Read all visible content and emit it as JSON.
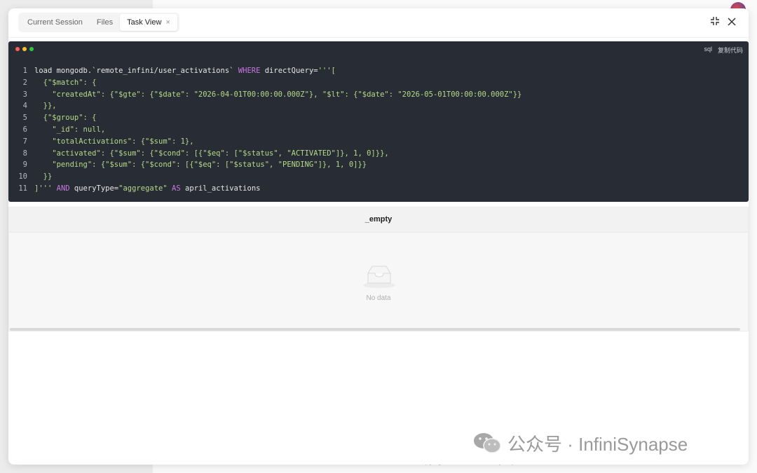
{
  "background": {
    "footer_text": "Copyright © 2025 InfiniSynapse"
  },
  "tabs": [
    {
      "label": "Current Session",
      "active": false
    },
    {
      "label": "Files",
      "active": false
    },
    {
      "label": "Task View",
      "active": true
    }
  ],
  "tab_close_glyph": "×",
  "header_actions": {
    "collapse_icon": "⤡",
    "close_icon": "✕"
  },
  "code": {
    "language": "sql",
    "copy_label": "复制代码",
    "lines": [
      {
        "n": "1",
        "segments": [
          [
            "plain",
            "load mongodb.`remote_infini/user_activations` "
          ],
          [
            "kw",
            "WHERE"
          ],
          [
            "plain",
            " directQuery="
          ],
          [
            "str",
            "'''["
          ]
        ]
      },
      {
        "n": "2",
        "segments": [
          [
            "str",
            "  {\"$match\": {"
          ]
        ]
      },
      {
        "n": "3",
        "segments": [
          [
            "str",
            "    \"createdAt\": {\"$gte\": {\"$date\": \"2026-04-01T00:00:00.000Z\"}, \"$lt\": {\"$date\": \"2026-05-01T00:00:00.000Z\"}}"
          ]
        ]
      },
      {
        "n": "4",
        "segments": [
          [
            "str",
            "  }},"
          ]
        ]
      },
      {
        "n": "5",
        "segments": [
          [
            "str",
            "  {\"$group\": {"
          ]
        ]
      },
      {
        "n": "6",
        "segments": [
          [
            "str",
            "    \"_id\": null,"
          ]
        ]
      },
      {
        "n": "7",
        "segments": [
          [
            "str",
            "    \"totalActivations\": {\"$sum\": 1},"
          ]
        ]
      },
      {
        "n": "8",
        "segments": [
          [
            "str",
            "    \"activated\": {\"$sum\": {\"$cond\": [{\"$eq\": [\"$status\", \"ACTIVATED\"]}, 1, 0]}},"
          ]
        ]
      },
      {
        "n": "9",
        "segments": [
          [
            "str",
            "    \"pending\": {\"$sum\": {\"$cond\": [{\"$eq\": [\"$status\", \"PENDING\"]}, 1, 0]}}"
          ]
        ]
      },
      {
        "n": "10",
        "segments": [
          [
            "str",
            "  }}"
          ]
        ]
      },
      {
        "n": "11",
        "segments": [
          [
            "str",
            "]'''"
          ],
          [
            "plain",
            " "
          ],
          [
            "kw",
            "AND"
          ],
          [
            "plain",
            " queryType="
          ],
          [
            "str",
            "\"aggregate\""
          ],
          [
            "plain",
            " "
          ],
          [
            "kw",
            "AS"
          ],
          [
            "plain",
            " april_activations"
          ]
        ]
      }
    ]
  },
  "result": {
    "column_header": "_empty",
    "empty_text": "No data"
  },
  "watermark": {
    "text": "公众号 · InfiniSynapse",
    "icon": "wechat-icon"
  },
  "colors": {
    "code_bg": "#282c34",
    "keyword": "#c678dd",
    "string": "#b6d98a"
  }
}
